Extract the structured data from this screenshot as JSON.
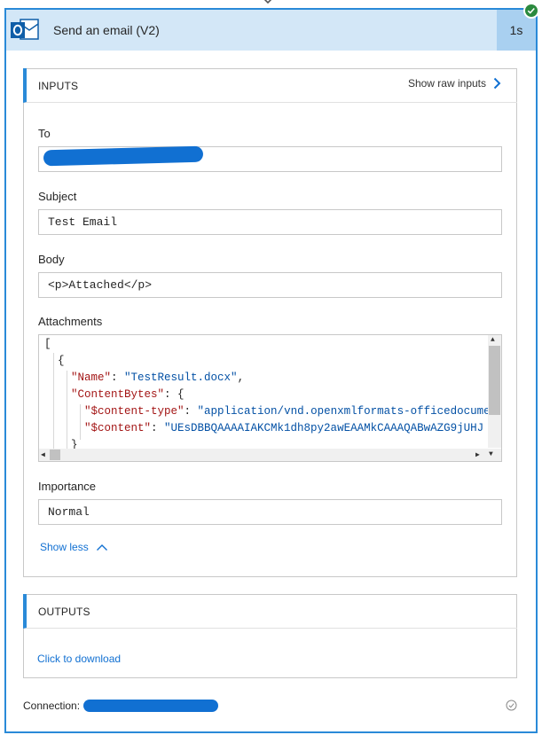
{
  "action": {
    "title": "Send an email (V2)",
    "duration": "1s",
    "status": "succeeded",
    "icon": "outlook-icon"
  },
  "inputs": {
    "section_title": "INPUTS",
    "raw_link": "Show raw inputs",
    "to": {
      "label": "To",
      "value": ""
    },
    "subject": {
      "label": "Subject",
      "value": "Test Email"
    },
    "body": {
      "label": "Body",
      "value": "<p>Attached</p>"
    },
    "attachments": {
      "label": "Attachments",
      "lines": {
        "open_bracket": "[",
        "open_brace": "{",
        "name_key": "\"Name\"",
        "name_value": "\"TestResult.docx\"",
        "content_bytes_key": "\"ContentBytes\"",
        "content_type_key": "\"$content-type\"",
        "content_type_value": "\"application/vnd.openxmlformats-officedocume",
        "content_key": "\"$content\"",
        "content_value": "\"UEsDBBQAAAAIAKCMk1dh8py2awEAAMkCAAAQABwAZG9jUHJ",
        "close_brace": "}"
      }
    },
    "importance": {
      "label": "Importance",
      "value": "Normal"
    },
    "show_less": "Show less"
  },
  "outputs": {
    "section_title": "OUTPUTS",
    "download_link": "Click to download"
  },
  "connection": {
    "label": "Connection:",
    "value": ""
  },
  "colors": {
    "accent": "#2a8ad8",
    "header_bg": "#d3e7f7",
    "duration_bg": "#a9d0f0",
    "link": "#1170d2",
    "success": "#2b8a3e",
    "redaction": "#1170d2"
  }
}
